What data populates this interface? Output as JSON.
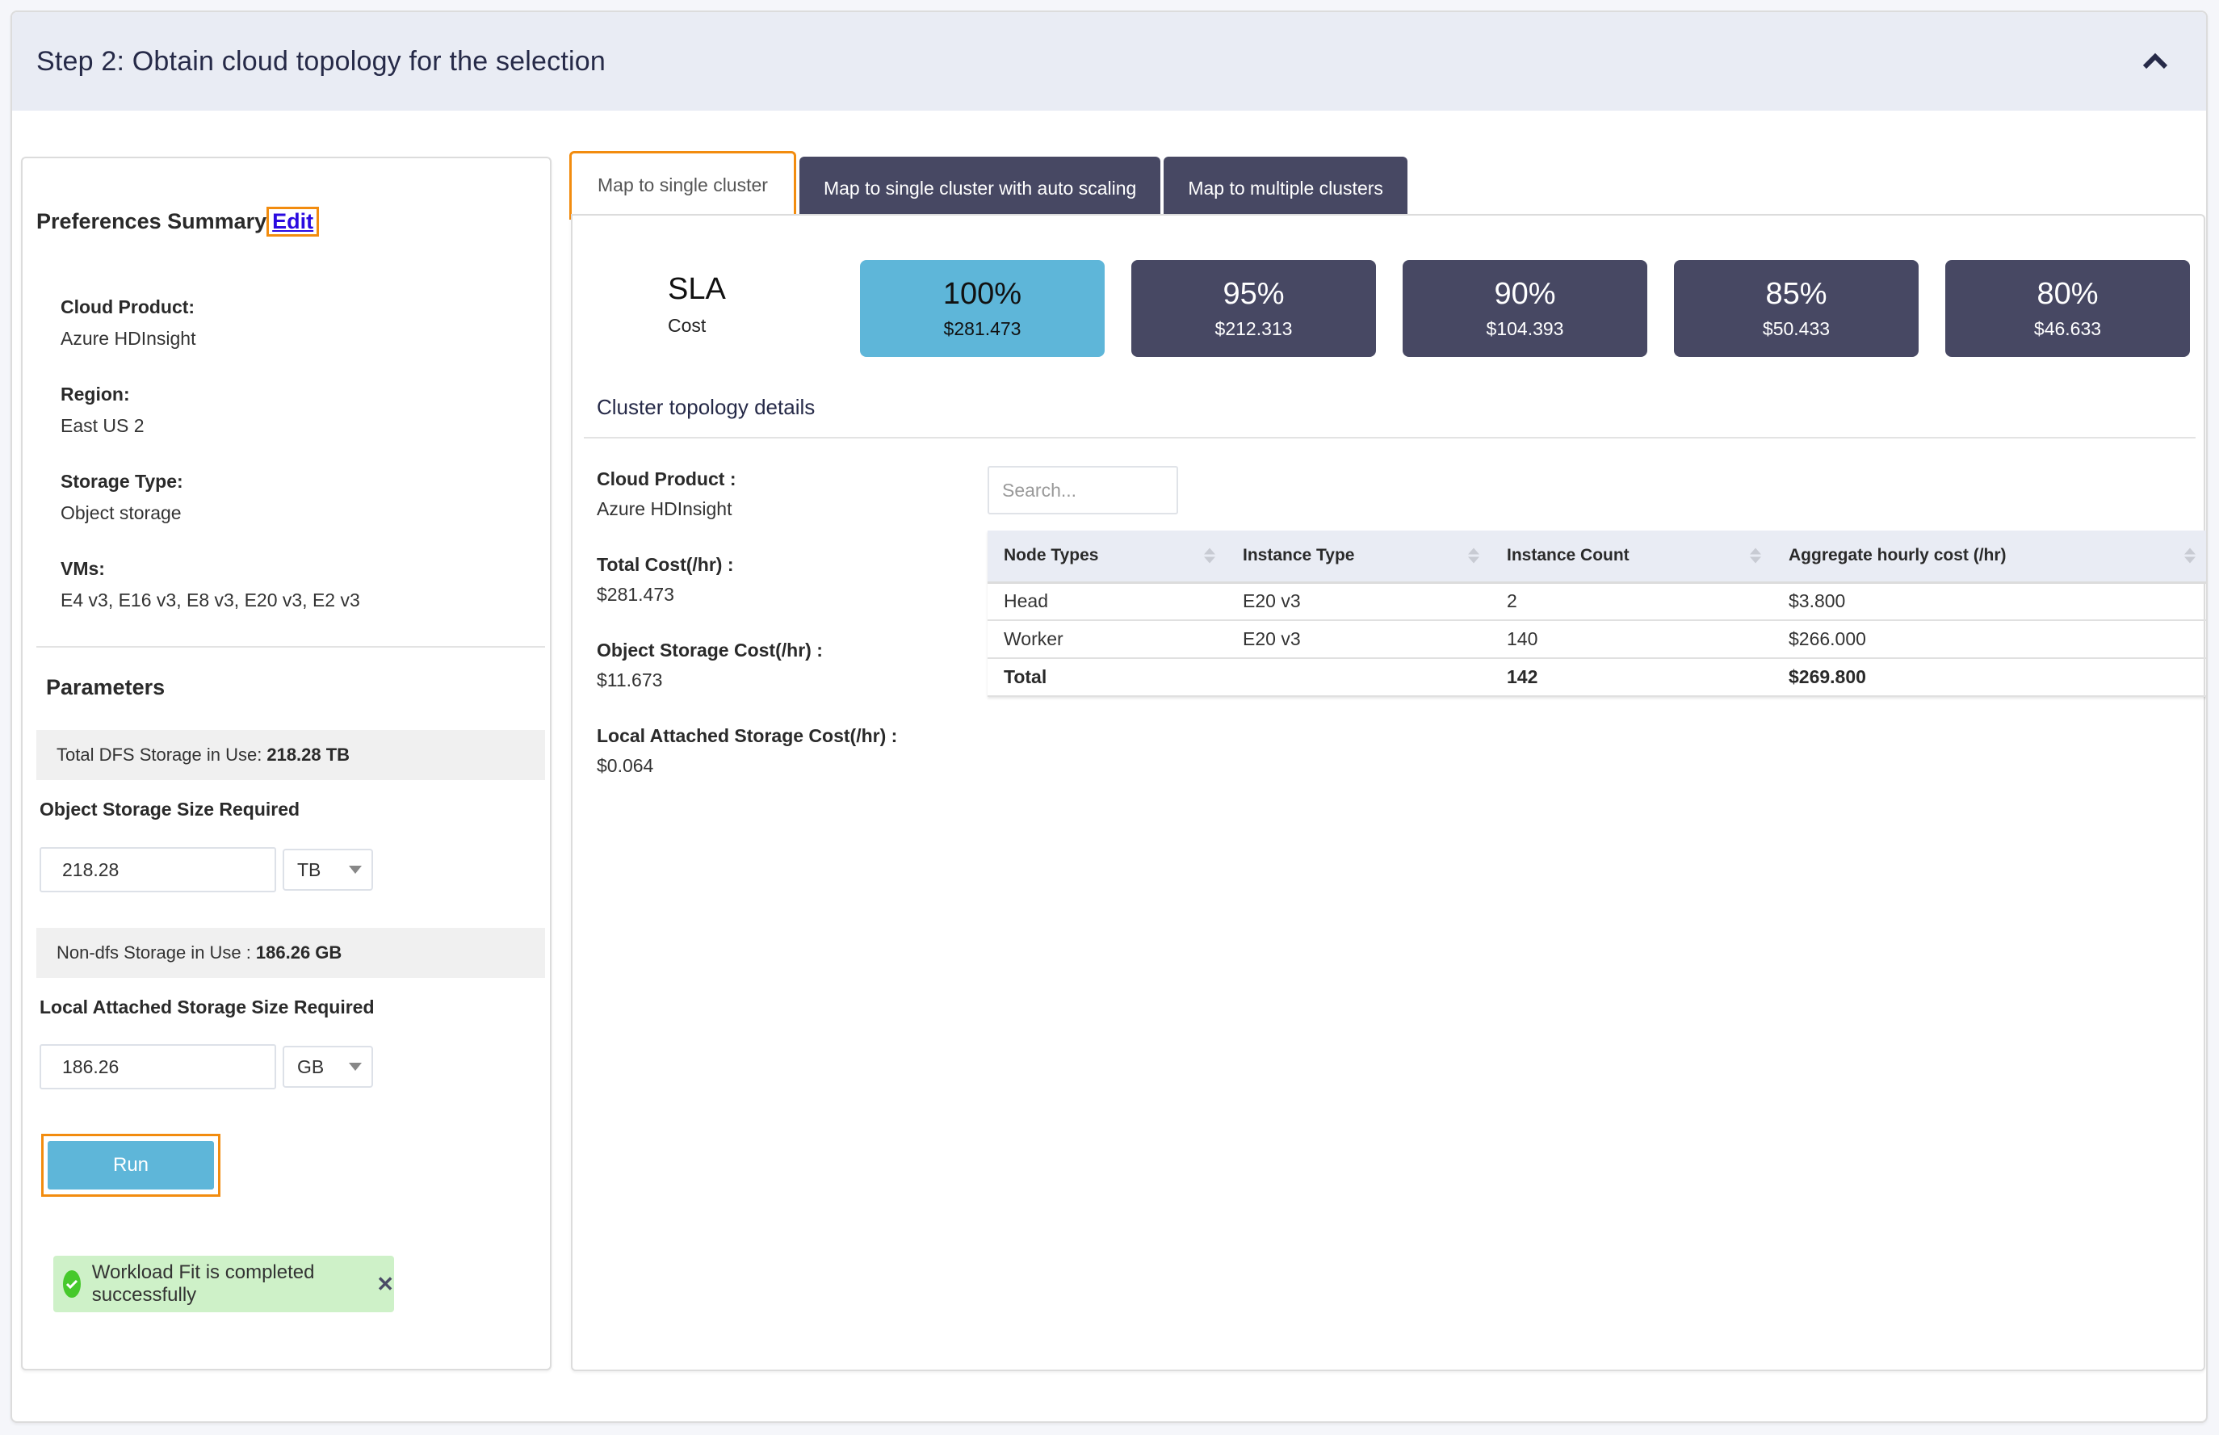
{
  "header": {
    "title": "Step 2: Obtain cloud topology for the selection",
    "collapse_icon": "chevron-up-icon"
  },
  "preferences": {
    "title": "Preferences Summary",
    "edit_label": "Edit",
    "items": [
      {
        "label": "Cloud Product:",
        "value": "Azure HDInsight"
      },
      {
        "label": "Region:",
        "value": "East US 2"
      },
      {
        "label": "Storage Type:",
        "value": "Object storage"
      },
      {
        "label": "VMs:",
        "value": "E4 v3, E16 v3, E8 v3, E20 v3, E2 v3"
      }
    ]
  },
  "parameters": {
    "title": "Parameters",
    "dfs_info_label": "Total DFS Storage in Use:",
    "dfs_info_value": "218.28 TB",
    "object_storage_label": "Object Storage Size Required",
    "object_storage_value": "218.28",
    "object_storage_unit": "TB",
    "nondfs_info_label": "Non-dfs Storage in Use :",
    "nondfs_info_value": "186.26 GB",
    "local_storage_label": "Local Attached Storage Size Required",
    "local_storage_value": "186.26",
    "local_storage_unit": "GB",
    "run_label": "Run"
  },
  "alert": {
    "message": "Workload Fit is completed successfully",
    "icon": "check-circle-icon",
    "close_icon": "close-icon"
  },
  "tabs": [
    {
      "label": "Map to single cluster",
      "active": true
    },
    {
      "label": "Map to single cluster with auto scaling",
      "active": false
    },
    {
      "label": "Map to multiple clusters",
      "active": false
    }
  ],
  "sla": {
    "title": "SLA",
    "subtitle": "Cost",
    "options": [
      {
        "pct": "100%",
        "cost": "$281.473",
        "selected": true
      },
      {
        "pct": "95%",
        "cost": "$212.313",
        "selected": false
      },
      {
        "pct": "90%",
        "cost": "$104.393",
        "selected": false
      },
      {
        "pct": "85%",
        "cost": "$50.433",
        "selected": false
      },
      {
        "pct": "80%",
        "cost": "$46.633",
        "selected": false
      }
    ]
  },
  "cluster_details": {
    "title": "Cluster topology details",
    "items": [
      {
        "label": "Cloud Product :",
        "value": "Azure HDInsight"
      },
      {
        "label": "Total Cost(/hr) :",
        "value": "$281.473"
      },
      {
        "label": "Object Storage Cost(/hr) :",
        "value": "$11.673"
      },
      {
        "label": "Local Attached Storage Cost(/hr) :",
        "value": "$0.064"
      }
    ],
    "search_placeholder": "Search...",
    "table": {
      "columns": [
        "Node Types",
        "Instance Type",
        "Instance Count",
        "Aggregate hourly cost (/hr)"
      ],
      "rows": [
        [
          "Head",
          "E20 v3",
          "2",
          "$3.800"
        ],
        [
          "Worker",
          "E20 v3",
          "140",
          "$266.000"
        ]
      ],
      "total": [
        "Total",
        "",
        "142",
        "$269.800"
      ]
    }
  },
  "colors": {
    "accent_blue": "#5eb6d9",
    "dark_slate": "#474863",
    "highlight_orange": "#f28c0f",
    "success_bg": "#cef1c8",
    "success_icon": "#46c92c"
  }
}
